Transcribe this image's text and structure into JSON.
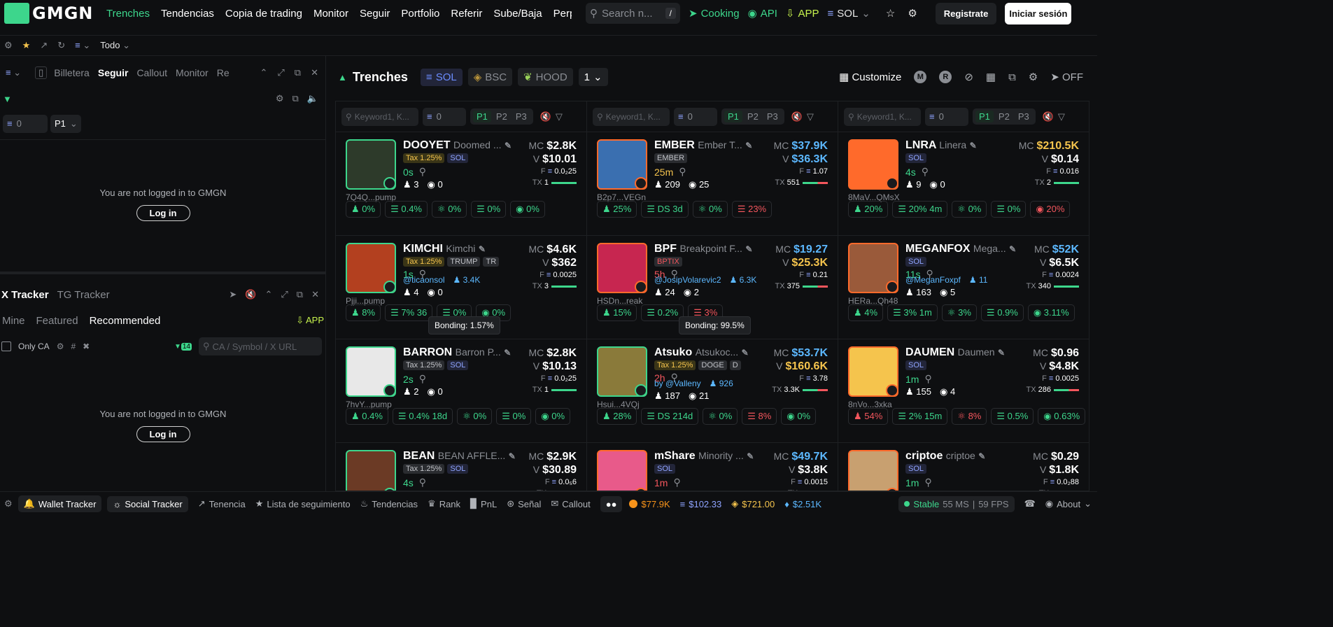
{
  "nav": {
    "logo": "GMGN",
    "links": [
      "Trenches",
      "Tendencias",
      "Copia de trading",
      "Monitor",
      "Seguir",
      "Portfolio",
      "Referir",
      "Sube/Baja",
      "Perp"
    ],
    "search_placeholder": "Search n...",
    "search_key": "/",
    "cooking": "Cooking",
    "api": "API",
    "app": "APP",
    "chain": "SOL",
    "register": "Registrate",
    "login": "Iniciar sesión"
  },
  "subbar": {
    "filter": "Todo"
  },
  "left": {
    "tabs": [
      "Billetera",
      "Seguir",
      "Callout",
      "Monitor",
      "Re"
    ],
    "num": "0",
    "pfilter": "P1",
    "not_logged": "You are not logged in to GMGN",
    "login": "Log in",
    "tracker": {
      "tabs": [
        "X Tracker",
        "TG Tracker"
      ],
      "subtabs": [
        "Mine",
        "Featured",
        "Recommended"
      ],
      "app": "APP",
      "only_ca": "Only CA",
      "badge": "14",
      "ca_placeholder": "CA / Symbol / X URL"
    }
  },
  "main": {
    "title": "Trenches",
    "chains": [
      "SOL",
      "BSC",
      "HOOD"
    ],
    "page": "1",
    "customize": "Customize",
    "m": "M",
    "r": "R",
    "off": "OFF",
    "filter": {
      "keyword": "Keyword1, K...",
      "num": "0",
      "p": [
        "P1",
        "P2",
        "P3"
      ]
    },
    "columns": [
      [
        {
          "sym": "DOOYET",
          "name": "Doomed ...",
          "tags": [
            [
              "y",
              "Tax 1.25%"
            ],
            [
              "s",
              "SOL"
            ]
          ],
          "age": "0s",
          "holders": "3",
          "views": "0",
          "addr": "7Q4Q...pump",
          "mc": "$2.8K",
          "v": "$10.01",
          "f": "0.0₂25",
          "tx": "1",
          "stats": [
            "0%",
            "0.4%",
            "0%",
            "0%",
            "0%"
          ],
          "color": "#2d3a2a",
          "orange": false
        },
        {
          "sym": "KIMCHI",
          "name": "Kimchi",
          "tags": [
            [
              "y",
              "Tax 1.25%"
            ],
            [
              "g",
              "TRUMP"
            ],
            [
              "g",
              "TR"
            ]
          ],
          "age": "1s",
          "holders": "4",
          "views": "0",
          "handle": "@ticaonsol",
          "followers": "3.4K",
          "addr": "Pjji...pump",
          "mc": "$4.6K",
          "v": "$362",
          "f": "0.0025",
          "tx": "3",
          "stats": [
            "8%",
            "7% 36",
            "",
            "0%",
            "0%"
          ],
          "color": "#b3401f",
          "orange": false
        },
        {
          "sym": "BARRON",
          "name": "Barron P...",
          "tags": [
            [
              "g",
              "Tax 1.25%"
            ],
            [
              "s",
              "SOL"
            ]
          ],
          "age": "2s",
          "holders": "2",
          "views": "0",
          "addr": "7hvY...pump",
          "mc": "$2.8K",
          "v": "$10.13",
          "f": "0.0₂25",
          "tx": "1",
          "stats": [
            "0.4%",
            "0.4% 18d",
            "0%",
            "0%",
            "0%"
          ],
          "color": "#e8e8e8",
          "orange": false
        },
        {
          "sym": "BEAN",
          "name": "BEAN AFFLE...",
          "tags": [
            [
              "g",
              "Tax 1.25%"
            ],
            [
              "s",
              "SOL"
            ]
          ],
          "age": "4s",
          "holders": "",
          "views": "",
          "addr": "",
          "mc": "$2.9K",
          "v": "$30.89",
          "f": "0.0₅6",
          "tx": "",
          "stats": [],
          "color": "#6b3a25",
          "orange": false
        }
      ],
      [
        {
          "sym": "EMBER",
          "name": "Ember T...",
          "tags": [
            [
              "g",
              "EMBER"
            ]
          ],
          "age": "25m",
          "holders": "209",
          "views": "25",
          "addr": "B2p7...VEGn",
          "mc": "$37.9K",
          "v": "$36.3K",
          "f": "1.07",
          "tx": "551",
          "stats": [
            "25%",
            "DS 3d",
            "0%",
            "23%"
          ],
          "color": "#3a6fb0",
          "orange": true
        },
        {
          "sym": "BPF",
          "name": "Breakpoint F...",
          "tags": [
            [
              "r",
              "BPTIX"
            ]
          ],
          "age": "5h",
          "holders": "24",
          "views": "2",
          "handle": "@JosipVolarevic2",
          "followers": "6.3K",
          "addr": "HSDn...reak",
          "mc": "$19.27",
          "v": "$25.3K",
          "f": "0.21",
          "tx": "375",
          "stats": [
            "15%",
            "0.2%",
            "",
            "3%"
          ],
          "color": "#c72650",
          "orange": true
        },
        {
          "sym": "Atsuko",
          "name": "Atsukoc...",
          "tags": [
            [
              "y",
              "Tax 1.25%"
            ],
            [
              "g",
              "DOGE"
            ],
            [
              "g",
              "D"
            ]
          ],
          "age": "2h",
          "holders": "187",
          "views": "21",
          "handle": "by @Valleny",
          "followers": "926",
          "addr": "Hsui...4VQj",
          "mc": "$53.7K",
          "v": "$160.6K",
          "f": "3.78",
          "tx": "3.3K",
          "stats": [
            "28%",
            "DS 214d",
            "0%",
            "8%",
            "0%"
          ],
          "color": "#8a7a3a",
          "orange": false
        },
        {
          "sym": "mShare",
          "name": "Minority ...",
          "tags": [
            [
              "s",
              "SOL"
            ]
          ],
          "age": "1m",
          "holders": "",
          "views": "",
          "addr": "",
          "mc": "$49.7K",
          "v": "$3.8K",
          "f": "0.0015",
          "tx": "",
          "stats": [],
          "color": "#e85a8a",
          "orange": true
        }
      ],
      [
        {
          "sym": "LNRA",
          "name": "Linera",
          "tags": [
            [
              "s",
              "SOL"
            ]
          ],
          "age": "4s",
          "holders": "9",
          "views": "0",
          "addr": "8MaV...QMsX",
          "mc": "$210.5K",
          "v": "$0.14",
          "f": "0.016",
          "tx": "2",
          "stats": [
            "20%",
            "20% 4m",
            "0%",
            "0%",
            "20%"
          ],
          "color": "#ff6a2b",
          "orange": true
        },
        {
          "sym": "MEGANFOX",
          "name": "Mega...",
          "tags": [
            [
              "s",
              "SOL"
            ]
          ],
          "age": "11s",
          "holders": "163",
          "views": "5",
          "handle": "@MeganFoxpf",
          "followers": "11",
          "addr": "HERa...Qh48",
          "mc": "$52K",
          "v": "$6.5K",
          "f": "0.0024",
          "tx": "340",
          "stats": [
            "4%",
            "3% 1m",
            "3%",
            "0.9%",
            "3.11%"
          ],
          "color": "#9a5a3a",
          "orange": true
        },
        {
          "sym": "DAUMEN",
          "name": "Daumen",
          "tags": [
            [
              "s",
              "SOL"
            ]
          ],
          "age": "1m",
          "holders": "155",
          "views": "4",
          "addr": "8nVo...3xka",
          "mc": "$0.96",
          "v": "$4.8K",
          "f": "0.0025",
          "tx": "286",
          "stats": [
            "54%",
            "2% 15m",
            "8%",
            "0.5%",
            "0.63%"
          ],
          "color": "#f5c44d",
          "orange": true
        },
        {
          "sym": "criptoe",
          "name": "criptoe",
          "tags": [
            [
              "s",
              "SOL"
            ]
          ],
          "age": "1m",
          "holders": "",
          "views": "",
          "addr": "",
          "mc": "$0.29",
          "v": "$1.8K",
          "f": "0.0₂88",
          "tx": "",
          "stats": [],
          "color": "#c8a070",
          "orange": true
        }
      ]
    ],
    "tooltips": [
      "Bonding: 1.57%",
      "Bonding: 99.5%"
    ]
  },
  "bottom": {
    "items": [
      "Wallet Tracker",
      "Social Tracker",
      "Tenencia",
      "Lista de seguimiento",
      "Tendencias",
      "Rank",
      "PnL",
      "Señal",
      "Callout"
    ],
    "prices": [
      "$77.9K",
      "$102.33",
      "$721.00",
      "$2.51K"
    ],
    "status": "Stable",
    "ms": "55 MS",
    "fps": "59 FPS",
    "about": "About"
  },
  "colors": {
    "accent": "#3dd68c",
    "red": "#f3565d",
    "blue": "#5cb8ff",
    "orange": "#ff6a2b"
  }
}
